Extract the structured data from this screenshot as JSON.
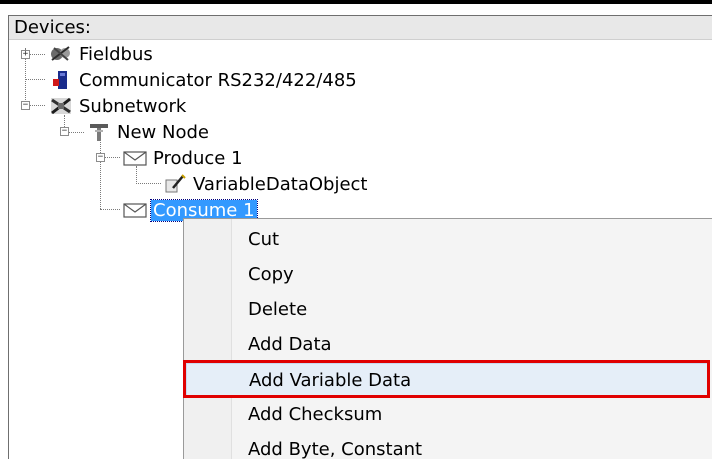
{
  "panel": {
    "header": "Devices:"
  },
  "tree": {
    "fieldbus": {
      "label": "Fieldbus",
      "expander": "+"
    },
    "communicator": {
      "label": "Communicator RS232/422/485"
    },
    "subnetwork": {
      "label": "Subnetwork",
      "expander": "−"
    },
    "new_node": {
      "label": "New Node",
      "expander": "−"
    },
    "produce": {
      "label": "Produce 1",
      "expander": "−"
    },
    "variable_data_object": {
      "label": "VariableDataObject"
    },
    "consume": {
      "label": "Consume 1",
      "selected": true
    }
  },
  "context_menu": {
    "items": [
      {
        "label": "Cut"
      },
      {
        "label": "Copy"
      },
      {
        "label": "Delete"
      },
      {
        "label": "Add Data"
      },
      {
        "label": "Add Variable Data"
      },
      {
        "label": "Add Checksum"
      },
      {
        "label": "Add Byte, Constant"
      }
    ]
  },
  "colors": {
    "selection": "#3399ff",
    "highlight_box": "#e00000"
  }
}
